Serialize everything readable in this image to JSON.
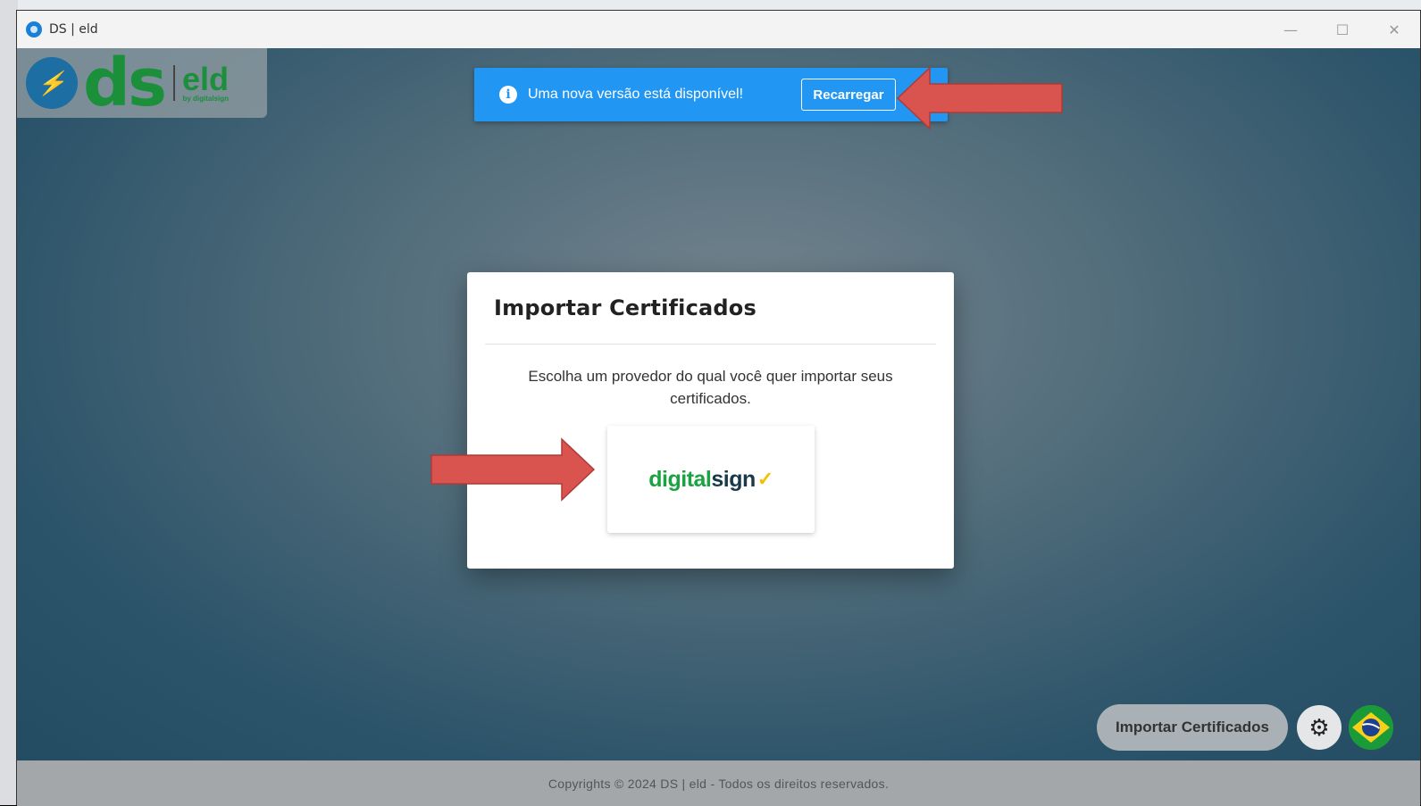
{
  "window": {
    "title": "DS | eld",
    "controls": {
      "minimize": "—",
      "maximize": "☐",
      "close": "✕"
    }
  },
  "logo": {
    "mark": "ds",
    "product": "eld",
    "byline": "by digitalsign"
  },
  "update_notice": {
    "message": "Uma nova versão está disponível!",
    "button": "Recarregar",
    "icon": "info-icon",
    "color": "#2196f3"
  },
  "dialog": {
    "title": "Importar Certificados",
    "description": "Escolha um provedor do qual você quer importar seus certificados.",
    "provider": {
      "name_part1": "digital",
      "name_part2": "sign"
    }
  },
  "bottom_actions": {
    "import_label": "Importar Certificados",
    "settings_icon": "gear-icon",
    "language_icon": "brazil-flag-icon"
  },
  "footer": {
    "text": "Copyrights © 2024 DS | eld - Todos os direitos reservados."
  }
}
